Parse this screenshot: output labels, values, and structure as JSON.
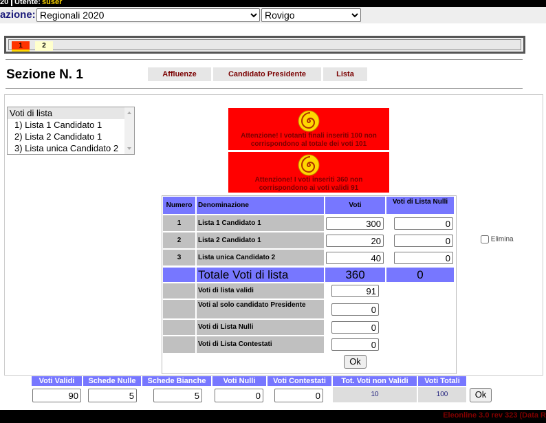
{
  "header": {
    "year_fragment": "20",
    "user_label": "Utente:",
    "user_name": "suser",
    "election_label": "azione:",
    "election_value": "Regionali 2020",
    "municipality_value": "Rovigo"
  },
  "section_tabs": [
    "1",
    "2"
  ],
  "section": {
    "title": "Sezione N. 1",
    "nav": [
      "Affluenze",
      "Candidato Presidente",
      "Lista"
    ]
  },
  "listbox": {
    "header": "Voti di lista",
    "items": [
      "1) Lista 1 Candidato 1",
      "2) Lista 2 Candidato 1",
      "3) Lista unica Candidato 2"
    ]
  },
  "warnings": [
    "Attenzione! I votanti finali inseriti 100 non corrispondono al totale dei voti 101",
    "Attenzione! I voti inseriti 360 non corrispondono ai voti validi 91"
  ],
  "table": {
    "headers": {
      "numero": "Numero",
      "denominazione": "Denominazione",
      "voti": "Voti",
      "nulli": "Voti di Lista Nulli"
    },
    "rows": [
      {
        "num": "1",
        "name": "Lista 1 Candidato 1",
        "voti": "300",
        "nulli": "0"
      },
      {
        "num": "2",
        "name": "Lista 2 Candidato 1",
        "voti": "20",
        "nulli": "0"
      },
      {
        "num": "3",
        "name": "Lista unica Candidato 2",
        "voti": "40",
        "nulli": "0"
      }
    ],
    "total_label": "Totale Voti di lista",
    "total_voti": "360",
    "total_nulli": "0",
    "extra": [
      {
        "label": "Voti di lista validi",
        "value": "91"
      },
      {
        "label": "Voti al solo candidato Presidente",
        "value": "0"
      },
      {
        "label": "Voti di Lista Nulli",
        "value": "0"
      },
      {
        "label": "Voti di Lista Contestati",
        "value": "0"
      }
    ],
    "ok_label": "Ok",
    "elimina_label": "Elimina"
  },
  "summary": {
    "headers": [
      "Voti Validi",
      "Schede Nulle",
      "Schede Bianche",
      "Voti Nulli",
      "Voti Contestati",
      "Tot. Voti non Validi",
      "Voti Totali"
    ],
    "values": [
      "90",
      "5",
      "5",
      "0",
      "0",
      "10",
      "100"
    ],
    "ok_label": "Ok"
  },
  "footer": {
    "text": "Eleonline 3.0 rev 323 (Data R"
  },
  "colors": {
    "warning": "#ff0000",
    "header_blue": "#7777ff",
    "tab_active": "#ff3300"
  }
}
